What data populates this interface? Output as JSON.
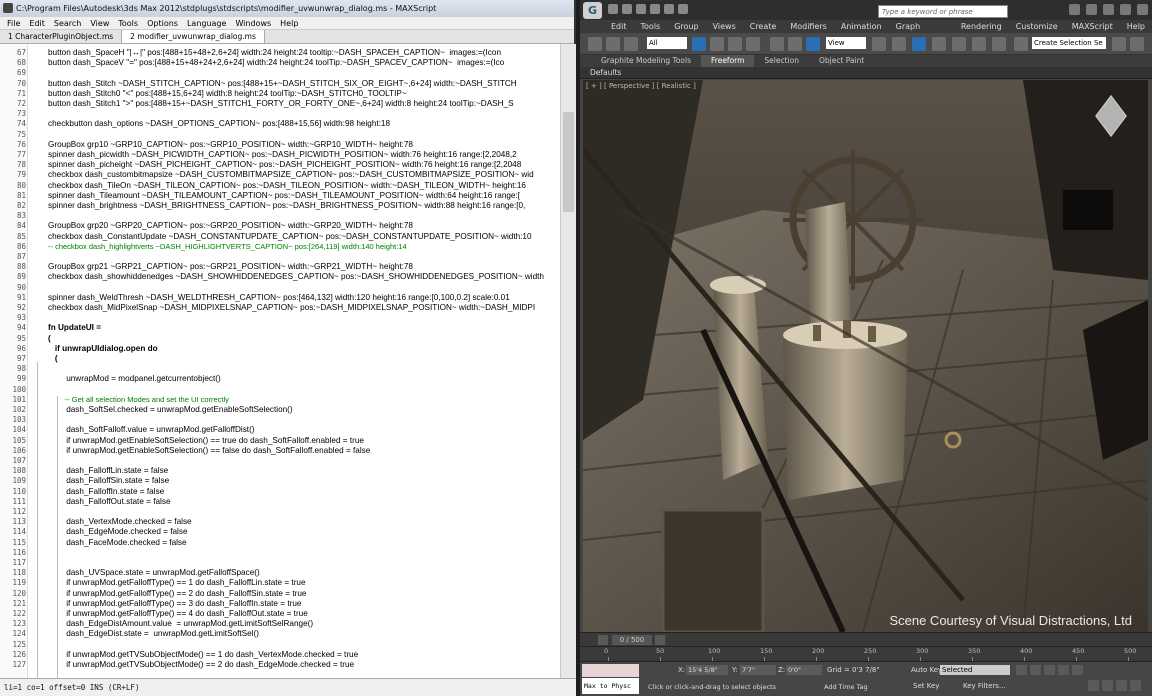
{
  "editor": {
    "title": "C:\\Program Files\\Autodesk\\3ds Max 2012\\stdplugs\\stdscripts\\modifier_uvwunwrap_dialog.ms - MAXScript",
    "menu": [
      "File",
      "Edit",
      "Search",
      "View",
      "Tools",
      "Options",
      "Language",
      "Windows",
      "Help"
    ],
    "tabs": [
      "1 CharacterPluginObject.ms",
      "2 modifier_uvwunwrap_dialog.ms"
    ],
    "status": "li=1 co=1 offset=0 INS (CR+LF)",
    "lines": [
      {
        "n": "67",
        "t": "button dash_SpaceH \"|↔|\" pos:[488+15+48+2,6+24] width:24 height:24 tooltip:~DASH_SPACEH_CAPTION~  images:=(Icon",
        "k": 0
      },
      {
        "n": "68",
        "t": "button dash_SpaceV \"=\" pos:[488+15+48+24+2,6+24] width:24 height:24 toolTip:~DASH_SPACEV_CAPTION~  images:=(Ico",
        "k": 0
      },
      {
        "n": "69",
        "t": "",
        "k": 0
      },
      {
        "n": "70",
        "t": "button dash_Stitch ~DASH_STITCH_CAPTION~ pos:[488+15+~DASH_STITCH_SIX_OR_EIGHT~,6+24] width:~DASH_STITCH",
        "k": 0
      },
      {
        "n": "71",
        "t": "button dash_Stitch0 \"<\" pos:[488+15,6+24] width:8 height:24 toolTip:~DASH_STITCH0_TOOLTIP~",
        "k": 0
      },
      {
        "n": "72",
        "t": "button dash_Stitch1 \">\" pos:[488+15+~DASH_STITCH1_FORTY_OR_FORTY_ONE~,6+24] width:8 height:24 toolTip:~DASH_S",
        "k": 0
      },
      {
        "n": "73",
        "t": "",
        "k": 0
      },
      {
        "n": "74",
        "t": "checkbutton dash_options ~DASH_OPTIONS_CAPTION~ pos:[488+15,56] width:98 height:18",
        "k": 0
      },
      {
        "n": "75",
        "t": "",
        "k": 0
      },
      {
        "n": "76",
        "t": "GroupBox grp10 ~GRP10_CAPTION~ pos:~GRP10_POSITION~ width:~GRP10_WIDTH~ height:78",
        "k": 0
      },
      {
        "n": "77",
        "t": "spinner dash_picwidth ~DASH_PICWIDTH_CAPTION~ pos:~DASH_PICWIDTH_POSITION~ width:76 height:16 range:[2,2048,2",
        "k": 0
      },
      {
        "n": "78",
        "t": "spinner dash_picheight ~DASH_PICHEIGHT_CAPTION~ pos:~DASH_PICHEIGHT_POSITION~ width:76 height:16 range:[2,2048",
        "k": 0
      },
      {
        "n": "79",
        "t": "checkbox dash_custombitmapsize ~DASH_CUSTOMBITMAPSIZE_CAPTION~ pos:~DASH_CUSTOMBITMAPSIZE_POSITION~ wid",
        "k": 0
      },
      {
        "n": "80",
        "t": "checkbox dash_TileOn ~DASH_TILEON_CAPTION~ pos:~DASH_TILEON_POSITION~ width:~DASH_TILEON_WIDTH~ height:16",
        "k": 0
      },
      {
        "n": "81",
        "t": "spinner dash_Tileamount ~DASH_TILEAMOUNT_CAPTION~ pos:~DASH_TILEAMOUNT_POSITION~ width:64 height:16 range:[",
        "k": 0
      },
      {
        "n": "82",
        "t": "spinner dash_brightness ~DASH_BRIGHTNESS_CAPTION~ pos:~DASH_BRIGHTNESS_POSITION~ width:88 height:16 range:[0,",
        "k": 0
      },
      {
        "n": "83",
        "t": "",
        "k": 0
      },
      {
        "n": "84",
        "t": "GroupBox grp20 ~GRP20_CAPTION~ pos:~GRP20_POSITION~ width:~GRP20_WIDTH~ height:78",
        "k": 0
      },
      {
        "n": "85",
        "t": "checkbox dash_ConstantUpdate ~DASH_CONSTANTUPDATE_CAPTION~ pos:~DASH_CONSTANTUPDATE_POSITION~ width:10",
        "k": 0
      },
      {
        "n": "86",
        "t": "-- checkbox dash_highlightverts ~DASH_HIGHLIGHTVERTS_CAPTION~ pos:[264,119] width:140 height:14",
        "k": 2
      },
      {
        "n": "87",
        "t": "",
        "k": 0
      },
      {
        "n": "88",
        "t": "GroupBox grp21 ~GRP21_CAPTION~ pos:~GRP21_POSITION~ width:~GRP21_WIDTH~ height:78",
        "k": 0
      },
      {
        "n": "89",
        "t": "checkbox dash_showhiddenedges ~DASH_SHOWHIDDENEDGES_CAPTION~ pos:~DASH_SHOWHIDDENEDGES_POSITION~ width",
        "k": 0
      },
      {
        "n": "90",
        "t": "",
        "k": 0
      },
      {
        "n": "91",
        "t": "spinner dash_WeldThresh ~DASH_WELDTHRESH_CAPTION~ pos:[464,132] width:120 height:16 range:[0,100,0.2] scale:0.01",
        "k": 0
      },
      {
        "n": "92",
        "t": "checkbox dash_MidPixelSnap ~DASH_MIDPIXELSNAP_CAPTION~ pos:~DASH_MIDPIXELSNAP_POSITION~ width:~DASH_MIDPI",
        "k": 0
      },
      {
        "n": "93",
        "t": "",
        "k": 0
      },
      {
        "n": "94",
        "t": "fn UpdateUI =",
        "k": 1
      },
      {
        "n": "95",
        "t": "(",
        "k": 1
      },
      {
        "n": "96",
        "t": "   if unwrapUIdialog.open do",
        "k": 1
      },
      {
        "n": "97",
        "t": "   (",
        "k": 1
      },
      {
        "n": "98",
        "t": "",
        "k": 0
      },
      {
        "n": "99",
        "t": "        unwrapMod = modpanel.getcurrentobject()",
        "k": 0
      },
      {
        "n": "100",
        "t": "",
        "k": 0
      },
      {
        "n": "101",
        "t": "        -- Get all selection Modes and set the UI correctly",
        "k": 2
      },
      {
        "n": "102",
        "t": "        dash_SoftSel.checked = unwrapMod.getEnableSoftSelection()",
        "k": 0
      },
      {
        "n": "103",
        "t": "",
        "k": 0
      },
      {
        "n": "104",
        "t": "        dash_SoftFalloff.value = unwrapMod.getFalloffDist()",
        "k": 0
      },
      {
        "n": "105",
        "t": "        if unwrapMod.getEnableSoftSelection() == true do dash_SoftFalloff.enabled = true",
        "k": 0
      },
      {
        "n": "106",
        "t": "        if unwrapMod.getEnableSoftSelection() == false do dash_SoftFalloff.enabled = false",
        "k": 0
      },
      {
        "n": "107",
        "t": "",
        "k": 0
      },
      {
        "n": "108",
        "t": "        dash_FalloffLin.state = false",
        "k": 0
      },
      {
        "n": "109",
        "t": "        dash_FalloffSin.state = false",
        "k": 0
      },
      {
        "n": "110",
        "t": "        dash_FalloffIn.state = false",
        "k": 0
      },
      {
        "n": "111",
        "t": "        dash_FalloffOut.state = false",
        "k": 0
      },
      {
        "n": "112",
        "t": "",
        "k": 0
      },
      {
        "n": "113",
        "t": "        dash_VertexMode.checked = false",
        "k": 0
      },
      {
        "n": "114",
        "t": "        dash_EdgeMode.checked = false",
        "k": 0
      },
      {
        "n": "115",
        "t": "        dash_FaceMode.checked = false",
        "k": 0
      },
      {
        "n": "116",
        "t": "",
        "k": 0
      },
      {
        "n": "117",
        "t": "",
        "k": 0
      },
      {
        "n": "118",
        "t": "        dash_UVSpace.state = unwrapMod.getFalloffSpace()",
        "k": 0
      },
      {
        "n": "119",
        "t": "        if unwrapMod.getFalloffType() == 1 do dash_FalloffLin.state = true",
        "k": 0
      },
      {
        "n": "120",
        "t": "        if unwrapMod.getFalloffType() == 2 do dash_FalloffSin.state = true",
        "k": 0
      },
      {
        "n": "121",
        "t": "        if unwrapMod.getFalloffType() == 3 do dash_FalloffIn.state = true",
        "k": 0
      },
      {
        "n": "122",
        "t": "        if unwrapMod.getFalloffType() == 4 do dash_FalloffOut.state = true",
        "k": 0
      },
      {
        "n": "123",
        "t": "        dash_EdgeDistAmount.value  = unwrapMod.getLimitSoftSelRange()",
        "k": 0
      },
      {
        "n": "124",
        "t": "        dash_EdgeDist.state =  unwrapMod.getLimitSoftSel()",
        "k": 0
      },
      {
        "n": "125",
        "t": "",
        "k": 0
      },
      {
        "n": "126",
        "t": "        if unwrapMod.getTVSubObjectMode() == 1 do dash_VertexMode.checked = true",
        "k": 0
      },
      {
        "n": "127",
        "t": "        if unwrapMod.getTVSubObjectMode() == 2 do dash_EdgeMode.checked = true",
        "k": 0
      }
    ]
  },
  "max": {
    "logo": "G",
    "search_placeholder": "Type a keyword or phrase",
    "menu": [
      "Edit",
      "Tools",
      "Group",
      "Views",
      "Create",
      "Modifiers",
      "Animation",
      "Graph Editors",
      "Rendering",
      "Customize",
      "MAXScript",
      "Help"
    ],
    "filter_select": "All",
    "refcoord_select": "View",
    "selection_set": "Create Selection Se",
    "ribbon_tabs": [
      "Graphite Modeling Tools",
      "Freeform",
      "Selection",
      "Object Paint"
    ],
    "ribbon_active": "Freeform",
    "ribbon_sub": "Defaults",
    "viewport_label": "[ + ] [ Perspective ] [ Realistic ]",
    "credit": "Scene Courtesy of Visual Distractions, Ltd",
    "timeline_frame": "0 / 500",
    "ruler_ticks": [
      "0",
      "50",
      "100",
      "150",
      "200",
      "250",
      "300",
      "350",
      "400",
      "450",
      "500"
    ],
    "maxscript_listener": "Max to Physc",
    "coord_labels": [
      "X:",
      "Y:",
      "Z:"
    ],
    "coord_values": [
      "15'4 5/8\"",
      "7'7\"",
      "0'0\""
    ],
    "grid": "Grid = 0'3 7/8\"",
    "prompt": "Click or click-and-drag to select objects",
    "add_time_tag": "Add Time Tag",
    "auto_key": "Auto Key",
    "set_key": "Set Key",
    "key_select": "Selected",
    "key_filters": "Key Filters...",
    "colors": {
      "accent": "#2a6fb5",
      "viewport_bg": "#1a1814",
      "panel": "#444444"
    }
  }
}
